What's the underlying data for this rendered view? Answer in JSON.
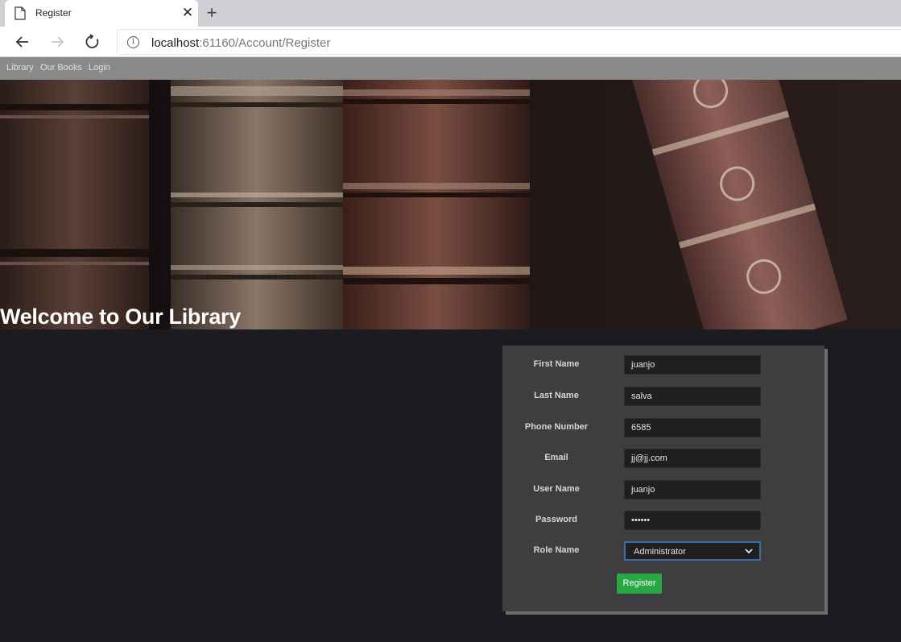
{
  "browser": {
    "tab_title": "Register",
    "tab_close": "✕",
    "new_tab": "+",
    "url_host": "localhost",
    "url_rest": ":61160/Account/Register"
  },
  "site_nav": {
    "items": [
      "Library",
      "Our Books",
      "Login"
    ]
  },
  "banner": {
    "title": "Welcome to Our Library"
  },
  "form": {
    "fields": [
      {
        "label": "First Name",
        "value": "juanjo"
      },
      {
        "label": "Last Name",
        "value": "salva"
      },
      {
        "label": "Phone Number",
        "value": "6585"
      },
      {
        "label": "Email",
        "value": "jj@jj.com"
      },
      {
        "label": "User Name",
        "value": "juanjo"
      },
      {
        "label": "Password",
        "value": "••••••"
      }
    ],
    "role": {
      "label": "Role Name",
      "selected": "Administrator"
    },
    "submit_label": "Register"
  },
  "icons": {
    "tab": "document-icon",
    "back": "arrow-left-icon",
    "forward": "arrow-right-icon",
    "reload": "reload-icon",
    "site_info": "info-icon",
    "select": "chevron-down-icon"
  },
  "colors": {
    "page_bg": "#1c1c20",
    "navbar_bg": "#8a8a8a",
    "panel_bg": "#3e3e40",
    "input_bg": "#1f1f22",
    "button_green": "#28a745",
    "select_focus": "#3b6ea8"
  }
}
